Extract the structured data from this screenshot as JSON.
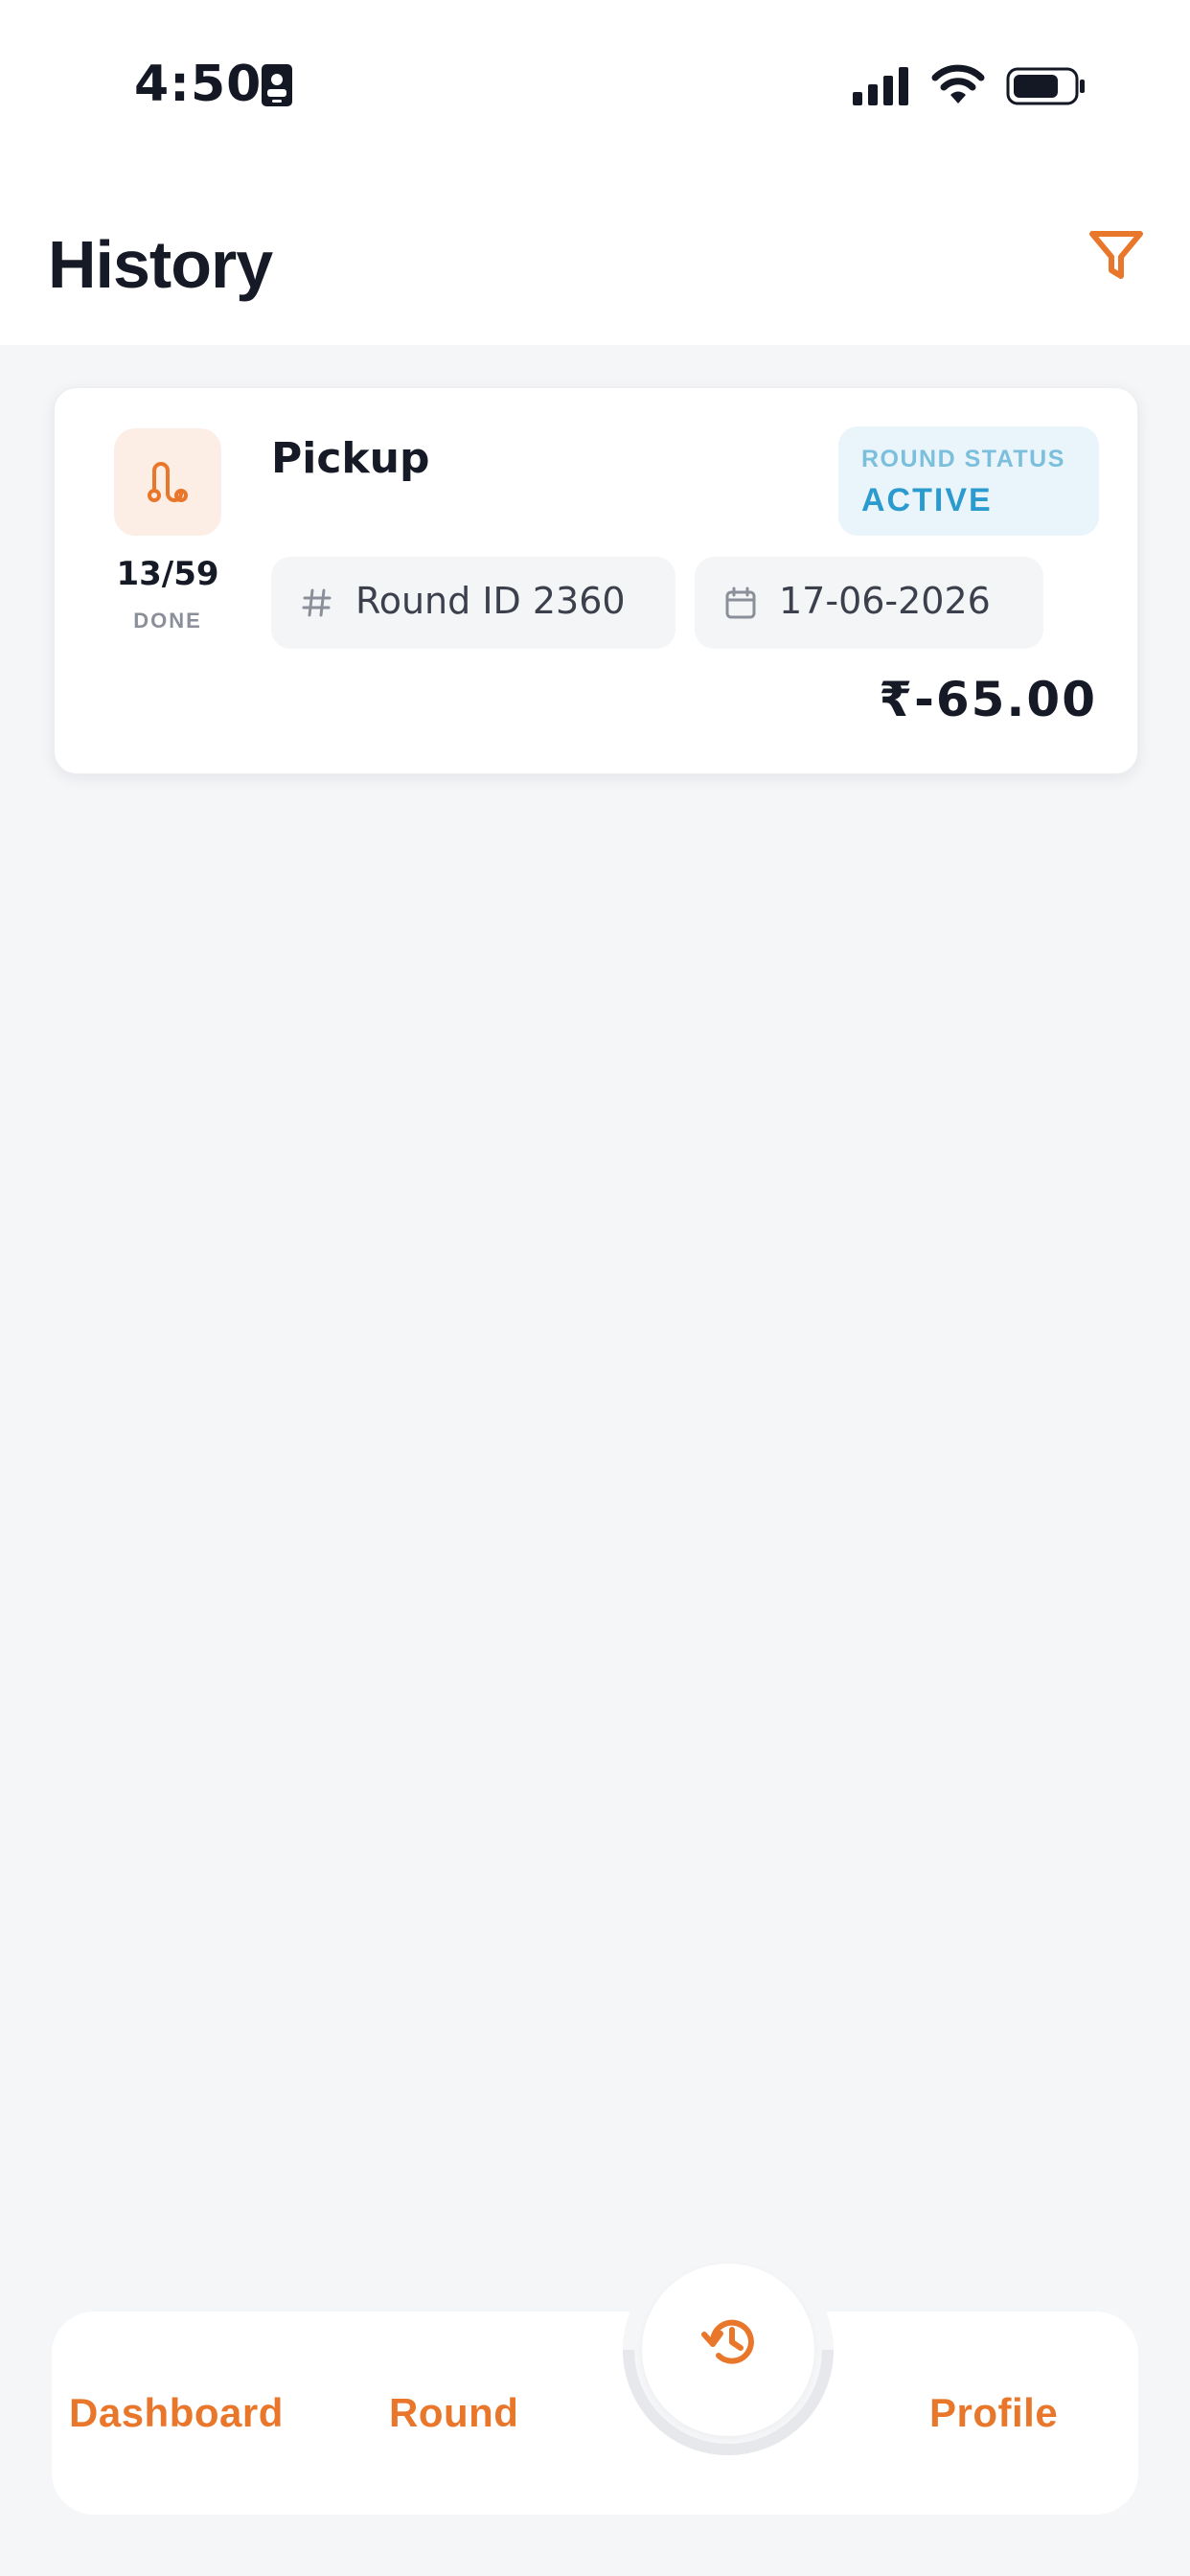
{
  "status_bar": {
    "time": "4:50"
  },
  "header": {
    "title": "History"
  },
  "history_items": [
    {
      "type": "Pickup",
      "progress": "13/59",
      "progress_label": "DONE",
      "status_label": "ROUND STATUS",
      "status_value": "ACTIVE",
      "round_id": "Round ID 2360",
      "date": "17-06-2026",
      "amount": "₹-65.00"
    }
  ],
  "bottom_nav": {
    "items": [
      "Dashboard",
      "Round",
      "Profile"
    ],
    "center_icon": "history-icon"
  },
  "colors": {
    "accent": "#e9772b",
    "status_bg": "#e9f5fa",
    "status_text": "#2b9bcf"
  }
}
